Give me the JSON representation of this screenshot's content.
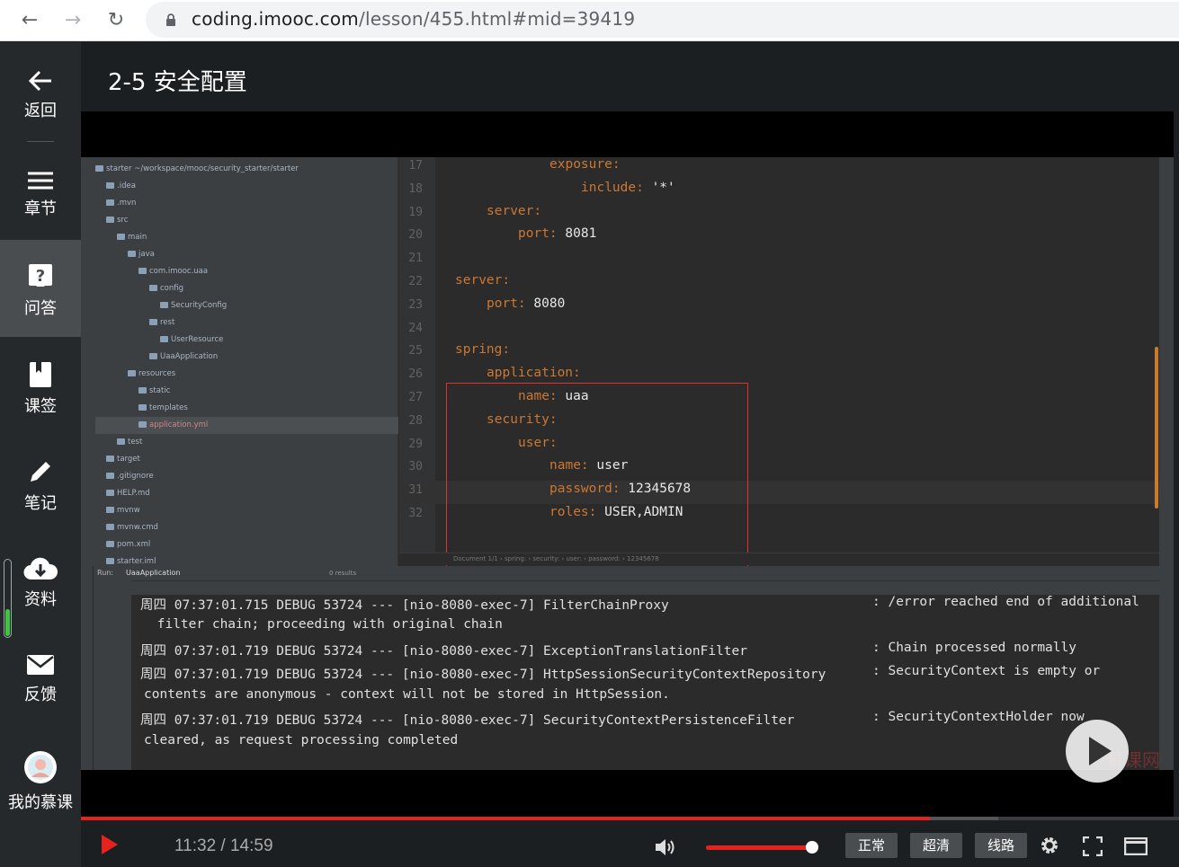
{
  "browser": {
    "url_host": "coding.imooc.com",
    "url_path": "/lesson/455.html#mid=39419"
  },
  "sidebar": {
    "items": [
      {
        "label": "返回",
        "icon": "back-arrow-icon"
      },
      {
        "label": "章节",
        "icon": "menu-list-icon"
      },
      {
        "label": "问答",
        "icon": "question-icon"
      },
      {
        "label": "课签",
        "icon": "bookmark-icon"
      },
      {
        "label": "笔记",
        "icon": "pencil-icon"
      },
      {
        "label": "资料",
        "icon": "cloud-download-icon"
      },
      {
        "label": "反馈",
        "icon": "mail-icon"
      },
      {
        "label": "我的慕课",
        "icon": "avatar"
      }
    ],
    "active_index": 2
  },
  "lesson": {
    "title": "2-5 安全配置"
  },
  "video": {
    "project_tree": [
      "starter  ~/workspace/mooc/security_starter/starter",
      ".idea",
      ".mvn",
      "src",
      "main",
      "java",
      "com.imooc.uaa",
      "config",
      "SecurityConfig",
      "rest",
      "UserResource",
      "UaaApplication",
      "resources",
      "static",
      "templates",
      "application.yml",
      "test",
      "target",
      ".gitignore",
      "HELP.md",
      "mvnw",
      "mvnw.cmd",
      "pom.xml",
      "starter.iml"
    ],
    "editor_lines": [
      {
        "n": "17",
        "key": "exposure:",
        "val": ""
      },
      {
        "n": "18",
        "key": "include:",
        "val": " '*'"
      },
      {
        "n": "19",
        "key": "server:",
        "val": ""
      },
      {
        "n": "20",
        "key": "port:",
        "val": " 8081"
      },
      {
        "n": "21",
        "key": "",
        "val": ""
      },
      {
        "n": "22",
        "key": "server:",
        "val": ""
      },
      {
        "n": "23",
        "key": "port:",
        "val": " 8080"
      },
      {
        "n": "24",
        "key": "",
        "val": ""
      },
      {
        "n": "25",
        "key": "spring:",
        "val": ""
      },
      {
        "n": "26",
        "key": "application:",
        "val": ""
      },
      {
        "n": "27",
        "key": "name:",
        "val": " uaa"
      },
      {
        "n": "28",
        "key": "security:",
        "val": ""
      },
      {
        "n": "29",
        "key": "user:",
        "val": ""
      },
      {
        "n": "30",
        "key": "name:",
        "val": " user"
      },
      {
        "n": "31",
        "key": "password:",
        "val": " 12345678"
      },
      {
        "n": "32",
        "key": "roles:",
        "val": " USER,ADMIN"
      }
    ],
    "breadcrumb": "Document 1/1  ›  spring:  ›  security:  ›  user:  ›  password:  ›  12345678",
    "run_label": "Run:",
    "run_tab": "UaaApplication",
    "search_results": "0 results",
    "console_lines": [
      {
        "main": "周四 07:37:01.715 DEBUG 53724 --- [nio-8080-exec-7] FilterChainProxy",
        "msg": ": /error reached end of additional"
      },
      {
        "main": " filter chain; proceeding with original chain",
        "msg": ""
      },
      {
        "main": "周四 07:37:01.719 DEBUG 53724 --- [nio-8080-exec-7] ExceptionTranslationFilter",
        "msg": ": Chain processed normally"
      },
      {
        "main": "周四 07:37:01.719 DEBUG 53724 --- [nio-8080-exec-7] HttpSessionSecurityContextRepository",
        "msg": ": SecurityContext is empty or"
      },
      {
        "main": "contents are anonymous - context will not be stored in HttpSession.",
        "msg": ""
      },
      {
        "main": "周四 07:37:01.719 DEBUG 53724 --- [nio-8080-exec-7] SecurityContextPersistenceFilter",
        "msg": ": SecurityContextHolder now"
      },
      {
        "main": "cleared, as request processing completed",
        "msg": ""
      }
    ],
    "watermark": "慕课网"
  },
  "player": {
    "current_time": "11:32",
    "separator": " / ",
    "duration": "14:59",
    "time_text": "11:32 / 14:59",
    "progress_fraction": 0.773,
    "volume_fraction": 0.98,
    "quality_buttons": [
      "正常",
      "超清",
      "线路"
    ],
    "accent_color": "#e5221e"
  }
}
